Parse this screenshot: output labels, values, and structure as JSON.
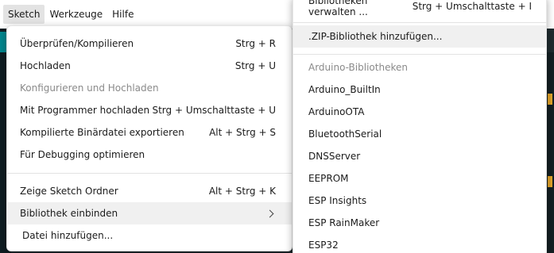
{
  "menubar": {
    "items": [
      "Sketch",
      "Werkzeuge",
      "Hilfe"
    ]
  },
  "sketch_menu": {
    "group1": [
      {
        "label": "Überprüfen/Kompilieren",
        "shortcut": "Strg + R",
        "disabled": false
      },
      {
        "label": "Hochladen",
        "shortcut": "Strg + U",
        "disabled": false
      },
      {
        "label": "Konfigurieren und Hochladen",
        "shortcut": "",
        "disabled": true
      },
      {
        "label": "Mit Programmer hochladen",
        "shortcut": "Strg + Umschalttaste + U",
        "disabled": false
      },
      {
        "label": "Kompilierte Binärdatei exportieren",
        "shortcut": "Alt + Strg + S",
        "disabled": false
      },
      {
        "label": "Für Debugging optimieren",
        "shortcut": "",
        "disabled": false
      }
    ],
    "group2": [
      {
        "label": "Zeige Sketch Ordner",
        "shortcut": "Alt + Strg + K"
      },
      {
        "label": "Bibliothek einbinden",
        "shortcut": ""
      },
      {
        "label": "Datei hinzufügen...",
        "shortcut": ""
      }
    ]
  },
  "library_menu": {
    "manage": {
      "label": "Bibliotheken verwalten ...",
      "shortcut": "Strg + Umschalttaste + I"
    },
    "add_zip": {
      "label": ".ZIP-Bibliothek hinzufügen..."
    },
    "header": "Arduino-Bibliotheken",
    "libraries": [
      "Arduino_BuiltIn",
      "ArduinoOTA",
      "BluetoothSerial",
      "DNSServer",
      "EEPROM",
      "ESP Insights",
      "ESP RainMaker",
      "ESP32"
    ]
  }
}
